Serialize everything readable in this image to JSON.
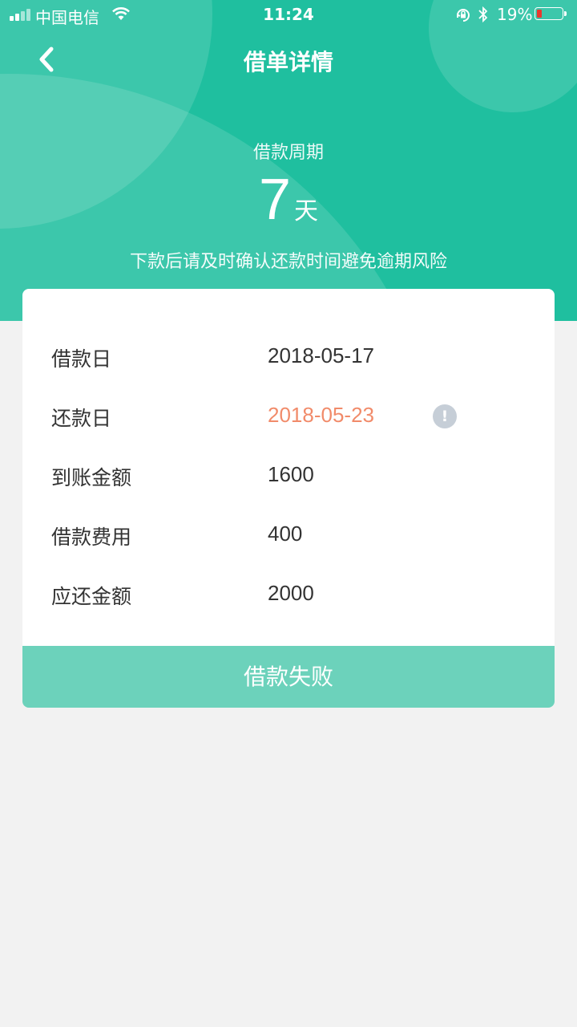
{
  "status_bar": {
    "carrier": "中国电信",
    "time": "11:24",
    "battery_text": "19%",
    "battery_level": 0.19
  },
  "nav": {
    "title": "借单详情",
    "back_icon": "chevron-left-icon"
  },
  "summary": {
    "cycle_label": "借款周期",
    "cycle_value": "7",
    "cycle_unit": "天",
    "notice": "下款后请及时确认还款时间避免逾期风险"
  },
  "details": [
    {
      "label": "借款日",
      "value": "2018-05-17"
    },
    {
      "label": "还款日",
      "value": "2018-05-23"
    },
    {
      "label": "到账金额",
      "value": "1600"
    },
    {
      "label": "借款费用",
      "value": "400"
    },
    {
      "label": "应还金额",
      "value": "2000"
    }
  ],
  "info_icon_text": "!",
  "action": {
    "label": "借款失败"
  },
  "colors": {
    "brand": "#1fbf9f",
    "button": "#6cd2bb",
    "highlight": "#f18b6a",
    "battery_low": "#e8382f"
  }
}
